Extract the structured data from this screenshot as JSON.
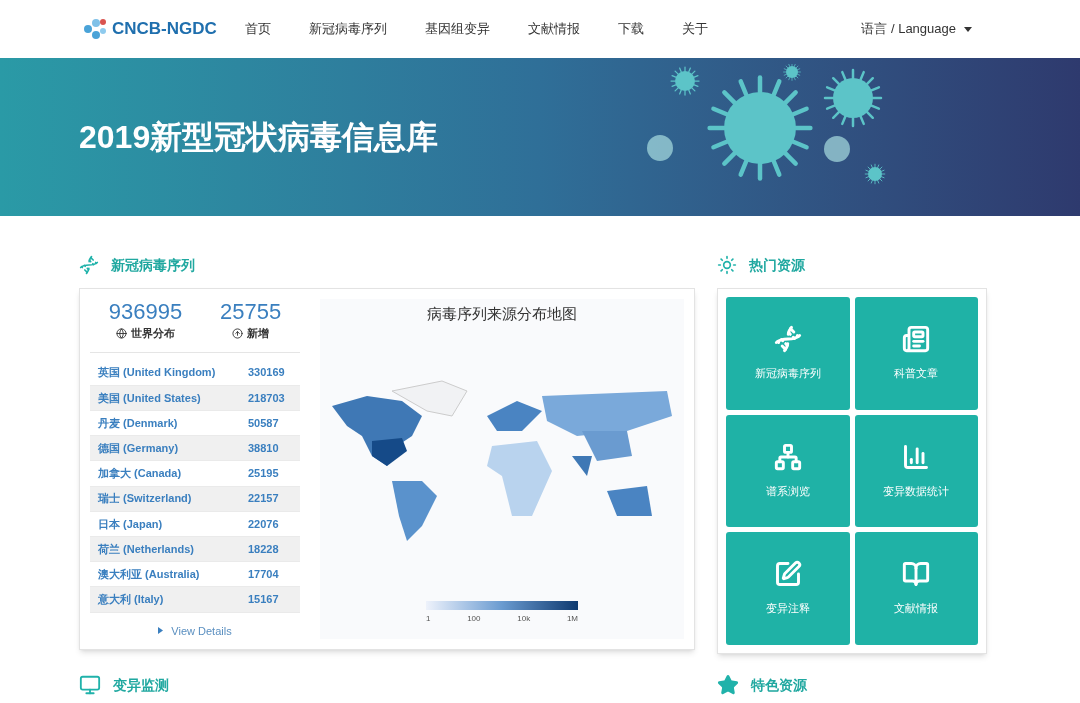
{
  "header": {
    "logo": "CNCB-NGDC",
    "nav": [
      "首页",
      "新冠病毒序列",
      "基因组变异",
      "文献情报",
      "下载",
      "关于"
    ],
    "language": "语言 / Language"
  },
  "banner": {
    "title": "2019新型冠状病毒信息库"
  },
  "sequences": {
    "title": "新冠病毒序列",
    "stats": [
      {
        "value": "936995",
        "label": "世界分布",
        "kind": "globe"
      },
      {
        "value": "25755",
        "label": "新增",
        "kind": "up"
      }
    ],
    "rows": [
      {
        "country": "英国 (United Kingdom)",
        "count": "330169"
      },
      {
        "country": "美国 (United States)",
        "count": "218703"
      },
      {
        "country": "丹麦 (Denmark)",
        "count": "50587"
      },
      {
        "country": "德国 (Germany)",
        "count": "38810"
      },
      {
        "country": "加拿大 (Canada)",
        "count": "25195"
      },
      {
        "country": "瑞士 (Switzerland)",
        "count": "22157"
      },
      {
        "country": "日本 (Japan)",
        "count": "22076"
      },
      {
        "country": "荷兰 (Netherlands)",
        "count": "18228"
      },
      {
        "country": "澳大利亚 (Australia)",
        "count": "17704"
      },
      {
        "country": "意大利 (Italy)",
        "count": "15167"
      }
    ],
    "details_link": "View Details",
    "map": {
      "title": "病毒序列来源分布地图",
      "legend": [
        "1",
        "100",
        "10k",
        "1M"
      ]
    }
  },
  "hot": {
    "title": "热门资源",
    "tiles": [
      {
        "label": "新冠病毒序列",
        "kind": "dna"
      },
      {
        "label": "科普文章",
        "kind": "news"
      },
      {
        "label": "谱系浏览",
        "kind": "tree"
      },
      {
        "label": "变异数据统计",
        "kind": "chart"
      },
      {
        "label": "变异注释",
        "kind": "edit"
      },
      {
        "label": "文献情报",
        "kind": "book"
      }
    ]
  },
  "bottom": [
    {
      "title": "变异监测",
      "kind": "monitor"
    },
    {
      "title": "特色资源",
      "kind": "star"
    }
  ]
}
